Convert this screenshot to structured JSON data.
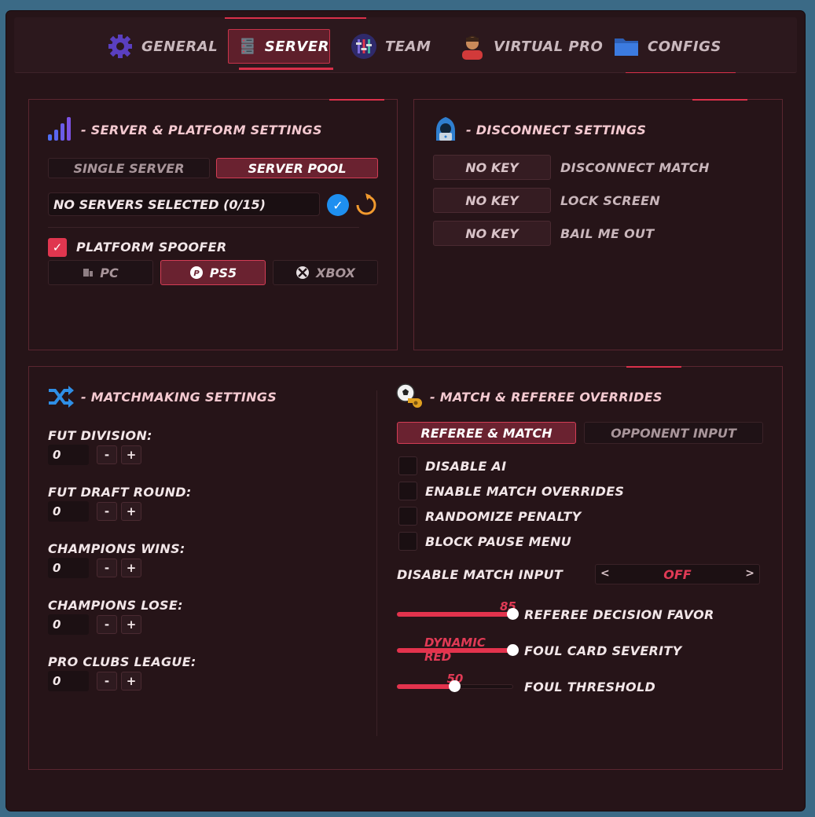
{
  "tabs": [
    {
      "label": "GENERAL",
      "icon": "gear-icon"
    },
    {
      "label": "SERVER",
      "icon": "server-icon",
      "active": true
    },
    {
      "label": "TEAM",
      "icon": "team-icon"
    },
    {
      "label": "VIRTUAL PRO",
      "icon": "avatar-icon"
    },
    {
      "label": "CONFIGS",
      "icon": "folder-icon"
    }
  ],
  "server_platform": {
    "title": "- SERVER & PLATFORM SETTINGS",
    "mode_buttons": [
      "SINGLE SERVER",
      "SERVER POOL"
    ],
    "active_mode": "SERVER POOL",
    "servers_field": "NO SERVERS SELECTED (0/15)",
    "platform_spoofer_label": "PLATFORM SPOOFER",
    "platform_spoofer_checked": true,
    "platforms": [
      "PC",
      "PS5",
      "XBOX"
    ],
    "active_platform": "PS5"
  },
  "disconnect": {
    "title": "- DISCONNECT SETTINGS",
    "rows": [
      {
        "key": "NO KEY",
        "action": "DISCONNECT MATCH"
      },
      {
        "key": "NO KEY",
        "action": "LOCK SCREEN"
      },
      {
        "key": "NO KEY",
        "action": "BAIL ME OUT"
      }
    ]
  },
  "matchmaking": {
    "title": "- MATCHMAKING SETTINGS",
    "fields": [
      {
        "label": "FUT DIVISION:",
        "value": "0"
      },
      {
        "label": "FUT DRAFT ROUND:",
        "value": "0"
      },
      {
        "label": "CHAMPIONS WINS:",
        "value": "0"
      },
      {
        "label": "CHAMPIONS LOSE:",
        "value": "0"
      },
      {
        "label": "PRO CLUBS LEAGUE:",
        "value": "0"
      }
    ],
    "minus": "-",
    "plus": "+"
  },
  "referee": {
    "title": "- MATCH & REFEREE OVERRIDES",
    "tabs": [
      "REFEREE & MATCH",
      "OPPONENT INPUT"
    ],
    "active_tab": "REFEREE & MATCH",
    "checkboxes": [
      {
        "label": "DISABLE AI",
        "checked": false
      },
      {
        "label": "ENABLE MATCH OVERRIDES",
        "checked": false
      },
      {
        "label": "RANDOMIZE PENALTY",
        "checked": false
      },
      {
        "label": "BLOCK PAUSE MENU",
        "checked": false
      }
    ],
    "disable_input_label": "DISABLE MATCH INPUT",
    "disable_input_value": "OFF",
    "arrow_left": "<",
    "arrow_right": ">",
    "sliders": [
      {
        "label": "REFEREE DECISION FAVOR",
        "value_text": "85",
        "fraction": 1.0
      },
      {
        "label": "FOUL CARD SEVERITY",
        "value_text": "DYNAMIC RED",
        "fraction": 1.0
      },
      {
        "label": "FOUL THRESHOLD",
        "value_text": "50",
        "fraction": 0.5
      }
    ]
  },
  "colors": {
    "accent": "#e3334d",
    "panel_bg": "#261418",
    "border": "#5a2630"
  }
}
